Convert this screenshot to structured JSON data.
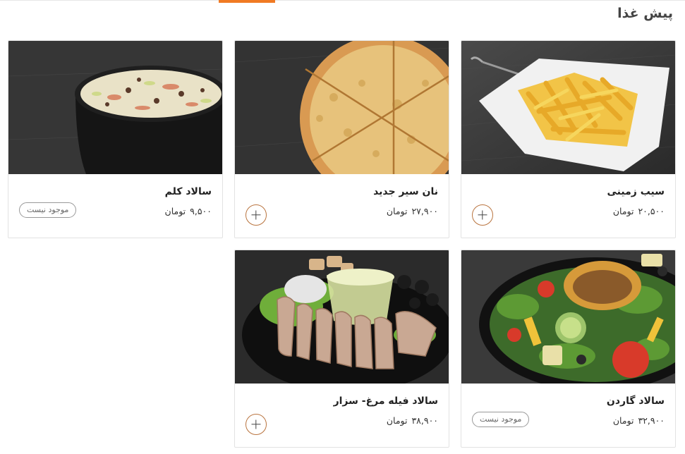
{
  "section": {
    "title": "پیش غذا"
  },
  "currency": "تومان",
  "add_icon": "plus-icon",
  "products": [
    {
      "id": "fries",
      "name": "سیب زمینی",
      "price": "۲۰,۵۰۰",
      "status": "available"
    },
    {
      "id": "garlic",
      "name": "نان سیر جدید",
      "price": "۲۷,۹۰۰",
      "status": "available"
    },
    {
      "id": "coleslaw",
      "name": "سالاد کلم",
      "price": "۹,۵۰۰",
      "status": "unavailable",
      "status_label": "موجود نیست"
    },
    {
      "id": "garden",
      "name": "سالاد گاردن",
      "price": "۳۲,۹۰۰",
      "status": "unavailable",
      "status_label": "موجود نیست"
    },
    {
      "id": "caesar",
      "name": "سالاد فیله مرغ- سزار",
      "price": "۳۸,۹۰۰",
      "status": "available"
    }
  ],
  "colors": {
    "accent": "#f07a24",
    "button_border": "#b9743f",
    "photo_background": "#2f2f2f"
  }
}
